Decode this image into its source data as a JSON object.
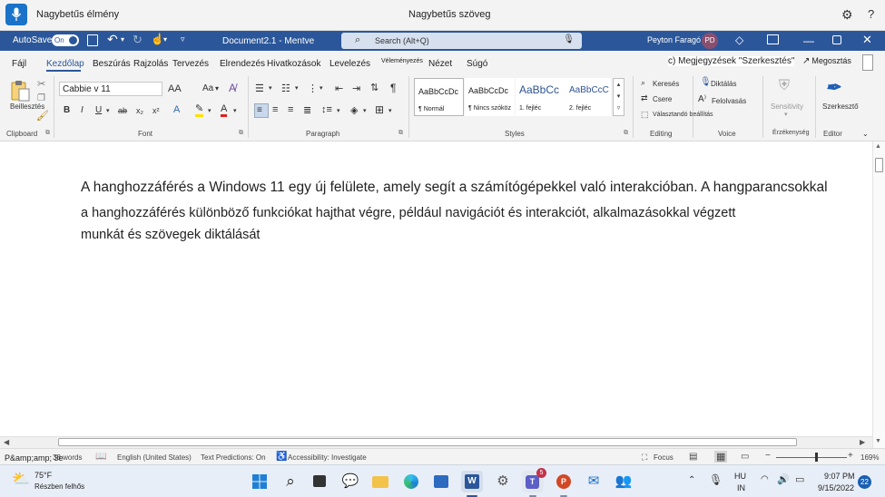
{
  "voice_bar": {
    "title": "Nagybetűs élmény",
    "center_text": "Nagybetűs szöveg",
    "gear": "⚙",
    "help": "?"
  },
  "title_bar": {
    "autosave_label": "AutoSave",
    "autosave_state": "On",
    "document_title": "Document2.1 - Mentve",
    "search_placeholder": "Search (Alt+Q)",
    "user_name": "Peyton Faragó",
    "user_initials": "PD",
    "accent": "#2b579a"
  },
  "tabs": [
    "Fájl",
    "Kezdőlap",
    "Beszúrás",
    "Rajzolás",
    "Tervezés",
    "Elrendezés",
    "Hivatkozások",
    "Levelezés",
    "Véleményezés",
    "Nézet",
    "Súgó"
  ],
  "active_tab": "Kezdőlap",
  "comments_label": "c) Megjegyzések \"Szerkesztés\"",
  "share_label": "Megosztás",
  "ribbon": {
    "clipboard": {
      "paste": "Beillesztés",
      "label": "Clipboard"
    },
    "font": {
      "name": "Cabbie v 11",
      "grow": "AA",
      "case": "Aa",
      "bold": "B",
      "italic": "I",
      "underline": "U",
      "strike": "ab",
      "sub": "x₂",
      "sup": "x²",
      "label": "Font"
    },
    "paragraph": {
      "label": "Paragraph",
      "pilcrow": "¶"
    },
    "styles": {
      "label": "Styles",
      "items": [
        {
          "preview": "AaBbCcDc",
          "name": "¶ Normál"
        },
        {
          "preview": "AaBbCcDc",
          "name": "¶ Nincs szóköz"
        },
        {
          "preview": "AaBbCc",
          "name": "1. fejléc"
        },
        {
          "preview": "AaBbCcC",
          "name": "2. fejléc"
        }
      ]
    },
    "editing": {
      "find": "Keresés",
      "replace": "Csere",
      "select": "Választandó beállítás",
      "label": "Editing"
    },
    "voice": {
      "dictate": "Diktálás",
      "read_aloud": "Felolvasás",
      "label": "Voice"
    },
    "sensitivity": {
      "button": "Sensitivity",
      "label": "Érzékenység"
    },
    "editor": {
      "button": "Szerkesztő",
      "label": "Editor"
    }
  },
  "document": {
    "lines": [
      "A hanghozzáférés a Windows 11 egy új felülete, amely segít a számítógépekkel való interakcióban. A hangparancsokkal",
      "a hanghozzáférés különböző funkciókat hajthat végre, például navigációt és interakciót, alkalmazásokkal végzett",
      "munkát és szövegek diktálását"
    ]
  },
  "status_bar": {
    "page": "P&amp;amp; 3e",
    "words": "38 words",
    "language": "English (United States)",
    "text_predictions": "Text Predictions: On",
    "accessibility": "Accessibility: Investigate",
    "focus": "Focus",
    "zoom": "169%"
  },
  "taskbar": {
    "weather_temp": "75°F",
    "weather_cond": "Részben felhős",
    "teams_badge": "5",
    "lang_top": "HU",
    "lang_bottom": "IN",
    "time": "9:07 PM",
    "date": "9/15/2022",
    "notifications": "22"
  }
}
